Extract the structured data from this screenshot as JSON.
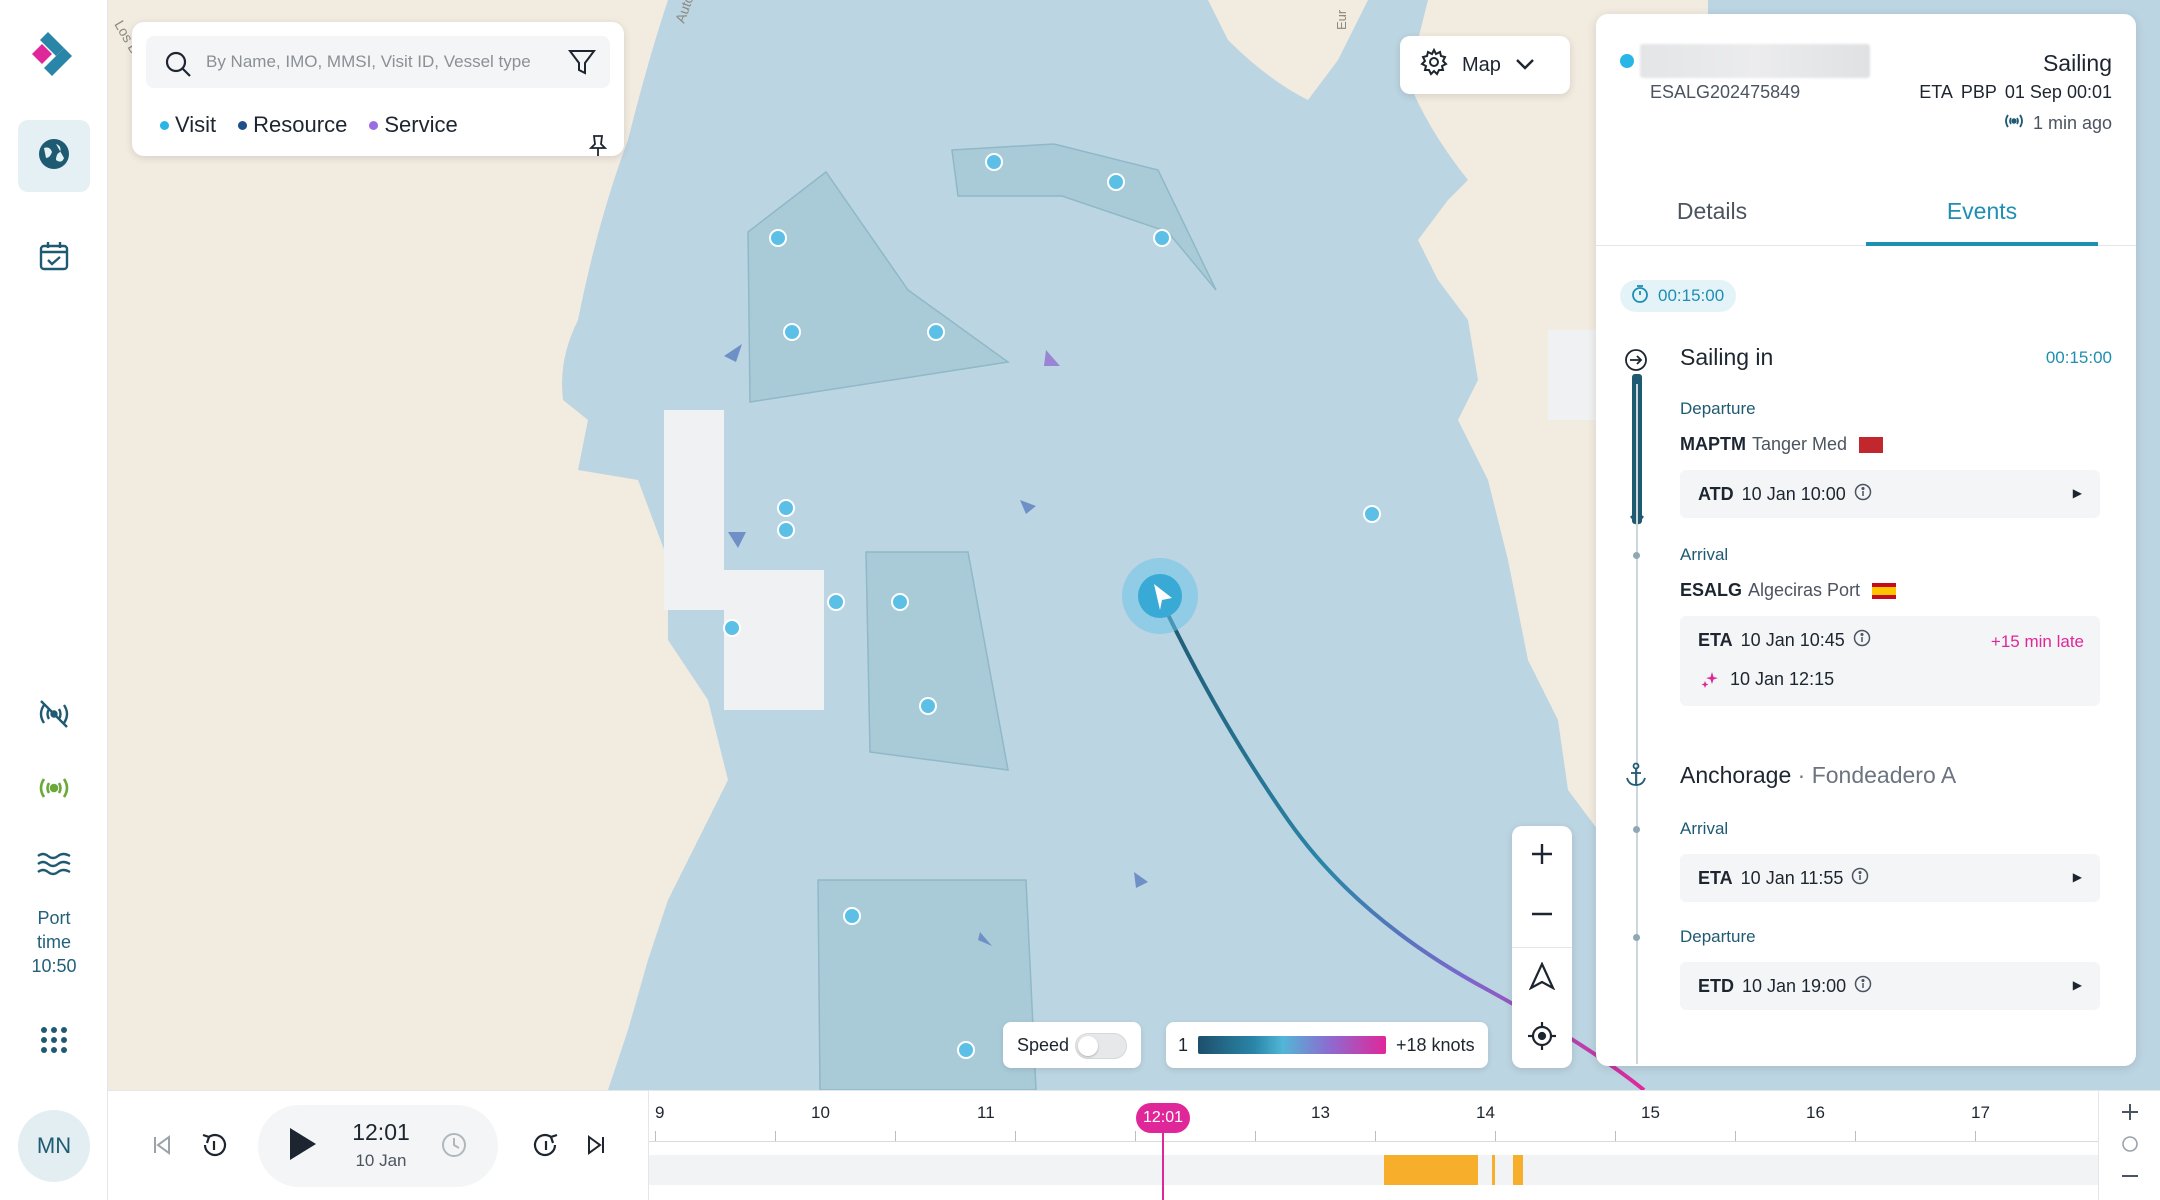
{
  "app": {
    "port_time_label": "Port time",
    "port_time_value": "10:50",
    "avatar_initials": "MN"
  },
  "search": {
    "placeholder": "By Name, IMO, MMSI, Visit ID, Vessel type",
    "legend": [
      {
        "label": "Visit",
        "color": "#29b6e6"
      },
      {
        "label": "Resource",
        "color": "#1f4e8c"
      },
      {
        "label": "Service",
        "color": "#9a6ee0"
      }
    ]
  },
  "map_select": {
    "label": "Map"
  },
  "map_labels": [
    "Los Ba",
    "Autov",
    "Eur"
  ],
  "speed": {
    "label": "Speed",
    "enabled": false,
    "scale_min": "1",
    "scale_max": "+18 knots"
  },
  "vessel": {
    "visit_id": "ESALG202475849",
    "state": "Sailing",
    "eta_label": "ETA",
    "eta_type": "PBP",
    "eta_value": "01 Sep 00:01",
    "updated": "1 min ago"
  },
  "tabs": [
    {
      "label": "Details",
      "active": false
    },
    {
      "label": "Events",
      "active": true
    }
  ],
  "events": {
    "duration": "00:15:00",
    "sailing": {
      "title": "Sailing in",
      "duration": "00:15:00",
      "departure_label": "Departure",
      "departure_code": "MAPTM",
      "departure_name": "Tanger Med",
      "atd_key": "ATD",
      "atd_value": "10 Jan 10:00",
      "arrival_label": "Arrival",
      "arrival_code": "ESALG",
      "arrival_name": "Algeciras Port",
      "eta_key": "ETA",
      "eta_value": "10 Jan 10:45",
      "late": "+15 min late",
      "predicted_value": "10 Jan 12:15"
    },
    "anchorage": {
      "title": "Anchorage",
      "subtitle": "Fondeadero A",
      "arrival_label": "Arrival",
      "eta_key": "ETA",
      "eta_value": "10 Jan 11:55",
      "departure_label": "Departure",
      "etd_key": "ETD",
      "etd_value": "10 Jan 19:00"
    }
  },
  "playback": {
    "time": "12:01",
    "date": "10 Jan",
    "cursor_label": "12:01",
    "ticks": [
      "9",
      "10",
      "11",
      "13",
      "14",
      "15",
      "16",
      "17"
    ]
  },
  "colors": {
    "accent": "#1e8fb3",
    "late": "#e0279a",
    "event_block": "#f7ae2a",
    "water": "#bcd5e2",
    "land": "#f2ebe0"
  }
}
